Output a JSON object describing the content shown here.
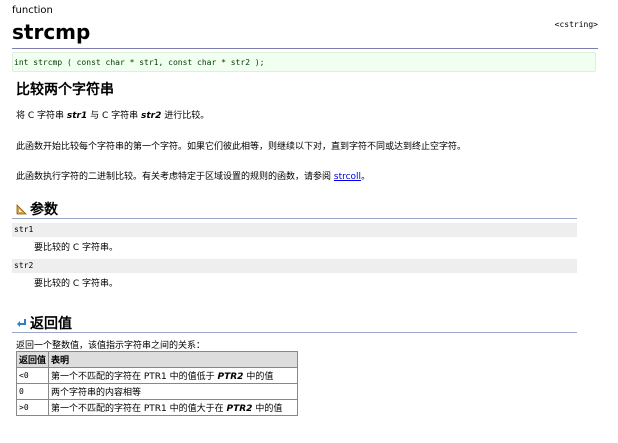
{
  "header": {
    "kind": "function",
    "title": "strcmp",
    "library": "<cstring>"
  },
  "prototype": "int strcmp ( const char * str1, const char * str2 );",
  "description": {
    "heading": "比较两个字符串",
    "p1_prefix": "将 C 字符串 ",
    "p1_str1": "str1",
    "p1_mid": " 与 C 字符串 ",
    "p1_str2": "str2",
    "p1_suffix": " 进行比较。",
    "p2": "此函数开始比较每个字符串的第一个字符。如果它们彼此相等，则继续以下对，直到字符不同或达到终止空字符。",
    "p3_prefix": "此函数执行字符的二进制比较。有关考虑特定于区域设置的规则的函数，请参阅 ",
    "p3_link": "strcoll",
    "p3_suffix": "。"
  },
  "params": {
    "heading": "参数",
    "icon": "ruler-triangle-icon",
    "items": [
      {
        "name": "str1",
        "desc": "要比较的 C 字符串。"
      },
      {
        "name": "str2",
        "desc": "要比较的 C 字符串。"
      }
    ]
  },
  "return": {
    "heading": "返回值",
    "icon": "return-arrow-icon",
    "text": "返回一个整数值，该值指示字符串之间的关系：",
    "col_value": "返回值",
    "col_desc": "表明",
    "rows": [
      {
        "code": "<0",
        "pre": "第一个不匹配的字符在 PTR1 中的值低于 ",
        "em": "PTR2",
        "post": " 中的值"
      },
      {
        "code": "0",
        "pre": "两个字符串的内容相等",
        "em": "",
        "post": ""
      },
      {
        "code": ">0",
        "pre": "第一个不匹配的字符在 PTR1 中的值大于在 ",
        "em": "PTR2",
        "post": " 中的值"
      }
    ]
  },
  "colors": {
    "rule": "#7f7faf",
    "proto_bg": "#f1fff1",
    "param_bg": "#eeeeee",
    "link": "#0000ee"
  }
}
